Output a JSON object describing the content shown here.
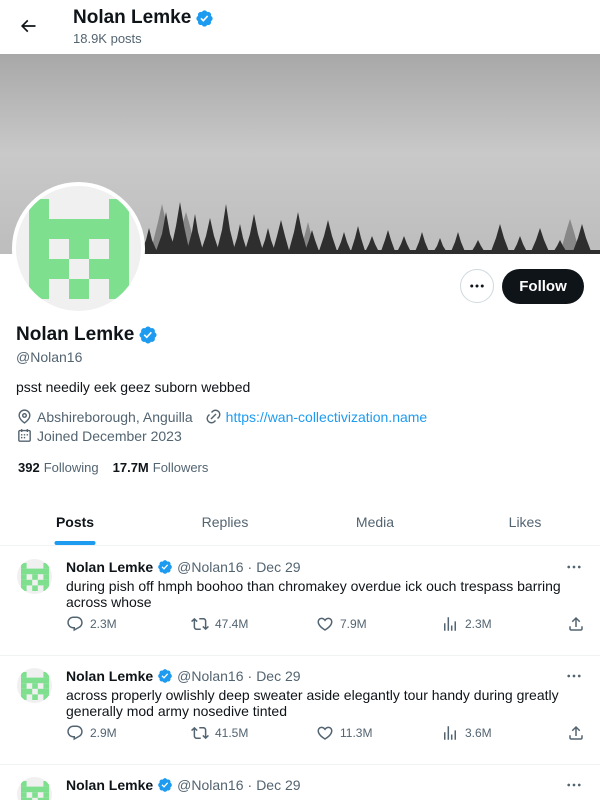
{
  "header": {
    "name": "Nolan Lemke",
    "posts_count": "18.9K posts"
  },
  "profile": {
    "name": "Nolan Lemke",
    "handle": "@Nolan16",
    "bio": "psst needily eek geez suborn webbed",
    "location": "Abshireborough, Anguilla",
    "website": "https://wan-collectivization.name",
    "joined": "Joined December 2023",
    "following_count": "392",
    "following_label": "Following",
    "followers_count": "17.7M",
    "followers_label": "Followers",
    "follow_label": "Follow"
  },
  "tabs": [
    {
      "label": "Posts",
      "active": true
    },
    {
      "label": "Replies",
      "active": false
    },
    {
      "label": "Media",
      "active": false
    },
    {
      "label": "Likes",
      "active": false
    }
  ],
  "posts": [
    {
      "author": "Nolan Lemke",
      "handle": "@Nolan16",
      "sep": "·",
      "date": "Dec 29",
      "text": "during pish off hmph boohoo than chromakey overdue ick ouch trespass barring across whose",
      "replies": "2.3M",
      "reposts": "47.4M",
      "likes": "7.9M",
      "views": "2.3M"
    },
    {
      "author": "Nolan Lemke",
      "handle": "@Nolan16",
      "sep": "·",
      "date": "Dec 29",
      "text": "across properly owlishly deep sweater aside elegantly tour handy during greatly generally mod army nosedive tinted",
      "replies": "2.9M",
      "reposts": "41.5M",
      "likes": "11.3M",
      "views": "3.6M"
    },
    {
      "author": "Nolan Lemke",
      "handle": "@Nolan16",
      "sep": "·",
      "date": "Dec 29",
      "text": "",
      "replies": "",
      "reposts": "",
      "likes": "",
      "views": ""
    }
  ],
  "colors": {
    "accent": "#1d9bf0",
    "text": "#0f1419",
    "muted": "#536471",
    "avatar_green": "#7ee08f",
    "follow_button": "#0f1419"
  },
  "icons": {
    "back": "arrow-left-icon",
    "verified": "verified-badge-icon",
    "more": "more-horizontal-icon",
    "location": "location-pin-icon",
    "link": "link-icon",
    "calendar": "calendar-icon",
    "reply": "reply-icon",
    "repost": "repost-icon",
    "like": "heart-icon",
    "views": "views-chart-icon",
    "share": "share-icon"
  }
}
